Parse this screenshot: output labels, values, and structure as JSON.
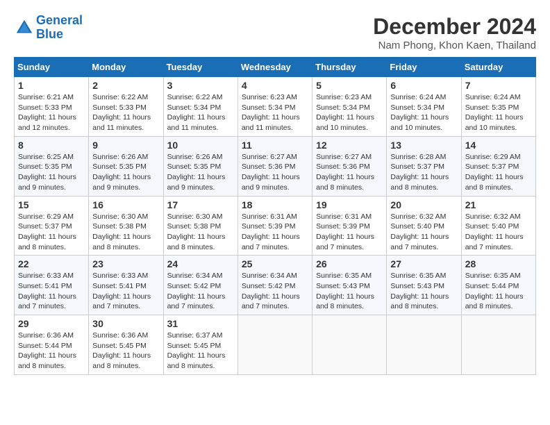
{
  "header": {
    "logo_line1": "General",
    "logo_line2": "Blue",
    "month_title": "December 2024",
    "location": "Nam Phong, Khon Kaen, Thailand"
  },
  "days_of_week": [
    "Sunday",
    "Monday",
    "Tuesday",
    "Wednesday",
    "Thursday",
    "Friday",
    "Saturday"
  ],
  "weeks": [
    [
      {
        "day": "1",
        "sunrise": "6:21 AM",
        "sunset": "5:33 PM",
        "daylight": "11 hours and 12 minutes."
      },
      {
        "day": "2",
        "sunrise": "6:22 AM",
        "sunset": "5:33 PM",
        "daylight": "11 hours and 11 minutes."
      },
      {
        "day": "3",
        "sunrise": "6:22 AM",
        "sunset": "5:34 PM",
        "daylight": "11 hours and 11 minutes."
      },
      {
        "day": "4",
        "sunrise": "6:23 AM",
        "sunset": "5:34 PM",
        "daylight": "11 hours and 11 minutes."
      },
      {
        "day": "5",
        "sunrise": "6:23 AM",
        "sunset": "5:34 PM",
        "daylight": "11 hours and 10 minutes."
      },
      {
        "day": "6",
        "sunrise": "6:24 AM",
        "sunset": "5:34 PM",
        "daylight": "11 hours and 10 minutes."
      },
      {
        "day": "7",
        "sunrise": "6:24 AM",
        "sunset": "5:35 PM",
        "daylight": "11 hours and 10 minutes."
      }
    ],
    [
      {
        "day": "8",
        "sunrise": "6:25 AM",
        "sunset": "5:35 PM",
        "daylight": "11 hours and 9 minutes."
      },
      {
        "day": "9",
        "sunrise": "6:26 AM",
        "sunset": "5:35 PM",
        "daylight": "11 hours and 9 minutes."
      },
      {
        "day": "10",
        "sunrise": "6:26 AM",
        "sunset": "5:35 PM",
        "daylight": "11 hours and 9 minutes."
      },
      {
        "day": "11",
        "sunrise": "6:27 AM",
        "sunset": "5:36 PM",
        "daylight": "11 hours and 9 minutes."
      },
      {
        "day": "12",
        "sunrise": "6:27 AM",
        "sunset": "5:36 PM",
        "daylight": "11 hours and 8 minutes."
      },
      {
        "day": "13",
        "sunrise": "6:28 AM",
        "sunset": "5:37 PM",
        "daylight": "11 hours and 8 minutes."
      },
      {
        "day": "14",
        "sunrise": "6:29 AM",
        "sunset": "5:37 PM",
        "daylight": "11 hours and 8 minutes."
      }
    ],
    [
      {
        "day": "15",
        "sunrise": "6:29 AM",
        "sunset": "5:37 PM",
        "daylight": "11 hours and 8 minutes."
      },
      {
        "day": "16",
        "sunrise": "6:30 AM",
        "sunset": "5:38 PM",
        "daylight": "11 hours and 8 minutes."
      },
      {
        "day": "17",
        "sunrise": "6:30 AM",
        "sunset": "5:38 PM",
        "daylight": "11 hours and 8 minutes."
      },
      {
        "day": "18",
        "sunrise": "6:31 AM",
        "sunset": "5:39 PM",
        "daylight": "11 hours and 7 minutes."
      },
      {
        "day": "19",
        "sunrise": "6:31 AM",
        "sunset": "5:39 PM",
        "daylight": "11 hours and 7 minutes."
      },
      {
        "day": "20",
        "sunrise": "6:32 AM",
        "sunset": "5:40 PM",
        "daylight": "11 hours and 7 minutes."
      },
      {
        "day": "21",
        "sunrise": "6:32 AM",
        "sunset": "5:40 PM",
        "daylight": "11 hours and 7 minutes."
      }
    ],
    [
      {
        "day": "22",
        "sunrise": "6:33 AM",
        "sunset": "5:41 PM",
        "daylight": "11 hours and 7 minutes."
      },
      {
        "day": "23",
        "sunrise": "6:33 AM",
        "sunset": "5:41 PM",
        "daylight": "11 hours and 7 minutes."
      },
      {
        "day": "24",
        "sunrise": "6:34 AM",
        "sunset": "5:42 PM",
        "daylight": "11 hours and 7 minutes."
      },
      {
        "day": "25",
        "sunrise": "6:34 AM",
        "sunset": "5:42 PM",
        "daylight": "11 hours and 7 minutes."
      },
      {
        "day": "26",
        "sunrise": "6:35 AM",
        "sunset": "5:43 PM",
        "daylight": "11 hours and 8 minutes."
      },
      {
        "day": "27",
        "sunrise": "6:35 AM",
        "sunset": "5:43 PM",
        "daylight": "11 hours and 8 minutes."
      },
      {
        "day": "28",
        "sunrise": "6:35 AM",
        "sunset": "5:44 PM",
        "daylight": "11 hours and 8 minutes."
      }
    ],
    [
      {
        "day": "29",
        "sunrise": "6:36 AM",
        "sunset": "5:44 PM",
        "daylight": "11 hours and 8 minutes."
      },
      {
        "day": "30",
        "sunrise": "6:36 AM",
        "sunset": "5:45 PM",
        "daylight": "11 hours and 8 minutes."
      },
      {
        "day": "31",
        "sunrise": "6:37 AM",
        "sunset": "5:45 PM",
        "daylight": "11 hours and 8 minutes."
      },
      null,
      null,
      null,
      null
    ]
  ],
  "labels": {
    "sunrise_label": "Sunrise:",
    "sunset_label": "Sunset:",
    "daylight_label": "Daylight:"
  }
}
